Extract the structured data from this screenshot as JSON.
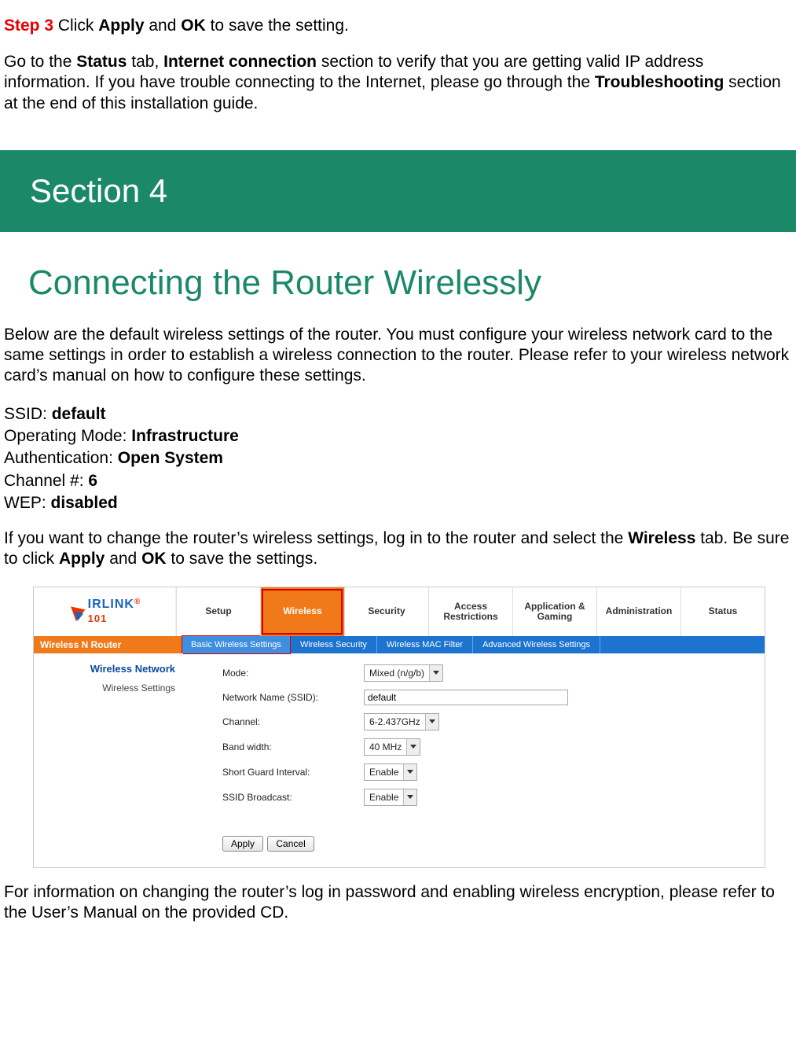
{
  "intro": {
    "step_label": "Step 3",
    "step_text_1": " Click ",
    "apply": "Apply",
    "step_and": " and ",
    "ok": "OK",
    "step_text_2": " to save the setting.",
    "status_para_1": "Go to the ",
    "status_tab": "Status",
    "status_para_2": " tab, ",
    "internet_conn": "Internet connection",
    "status_para_3": " section to verify that you are getting valid IP address information.  If you have trouble connecting to the Internet, please go through the ",
    "troubleshoot": "Troubleshooting",
    "status_para_4": " section at the end of this installation guide."
  },
  "section": {
    "banner": "Section 4",
    "title": "Connecting the Router Wirelessly",
    "desc": "Below are the default wireless settings of the router. You must configure your wireless network card to the same settings in order to establish a wireless connection to the router. Please refer to your wireless network card’s manual on how to configure these settings."
  },
  "defaults": {
    "ssid_lbl": "SSID: ",
    "ssid_val": "default",
    "mode_lbl": "Operating Mode: ",
    "mode_val": "Infrastructure",
    "auth_lbl": "Authentication: ",
    "auth_val": "Open System",
    "chan_lbl": "Channel #: ",
    "chan_val": "6",
    "wep_lbl": "WEP: ",
    "wep_val": "disabled"
  },
  "change_para": {
    "p1": "If you want to change the router’s wireless settings, log in to the router and select the ",
    "wireless": "Wireless",
    "p2": " tab. Be sure to click ",
    "apply": "Apply",
    "and": " and ",
    "ok": "OK",
    "p3": " to save the settings."
  },
  "router": {
    "logo_text_a": "IRLINK",
    "logo_text_101": "101",
    "tabs": [
      "Setup",
      "Wireless",
      "Security",
      "Access Restrictions",
      "Application & Gaming",
      "Administration",
      "Status"
    ],
    "active_tab_index": 1,
    "sub_left": "Wireless N Router",
    "sub_items": [
      "Basic Wireless Settings",
      "Wireless Security",
      "Wireless MAC Filter",
      "Advanced Wireless Settings"
    ],
    "sub_active_index": 0,
    "side_title": "Wireless Network",
    "side_label": "Wireless Settings",
    "form": {
      "mode_lbl": "Mode:",
      "mode_val": "Mixed (n/g/b)",
      "ssid_lbl": "Network Name (SSID):",
      "ssid_val": "default",
      "chan_lbl": "Channel:",
      "chan_val": "6-2.437GHz",
      "bw_lbl": "Band width:",
      "bw_val": "40 MHz",
      "sgi_lbl": "Short Guard Interval:",
      "sgi_val": "Enable",
      "bcast_lbl": "SSID Broadcast:",
      "bcast_val": "Enable"
    },
    "buttons": {
      "apply": "Apply",
      "cancel": "Cancel"
    }
  },
  "footer": {
    "text": "For information on changing the router’s log in password and enabling wireless encryption, please refer to the User’s Manual on the provided CD."
  }
}
